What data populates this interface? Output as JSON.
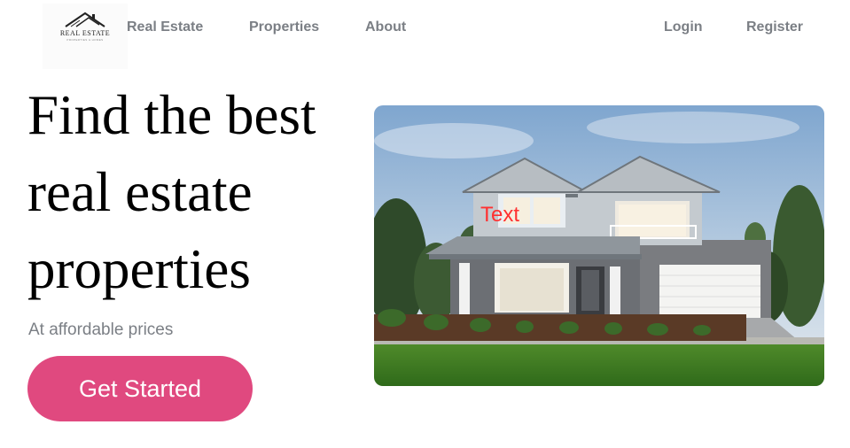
{
  "logo": {
    "text": "REAL ESTATE",
    "subtext": "PROPERTIES & HOMES",
    "icon": "house-roof-icon"
  },
  "nav": {
    "left": [
      "Real Estate",
      "Properties",
      "About"
    ],
    "right": [
      "Login",
      "Register"
    ]
  },
  "hero": {
    "title_line1": "Find the best",
    "title_line2": "real estate",
    "title_line3": "properties",
    "subtitle": "At affordable prices",
    "cta_label": "Get Started"
  },
  "image": {
    "overlay_text": "Text",
    "description_icon": "house-photo"
  },
  "colors": {
    "accent": "#e0497f",
    "nav_text": "#7b7f85",
    "overlay_text": "#ff3030"
  }
}
